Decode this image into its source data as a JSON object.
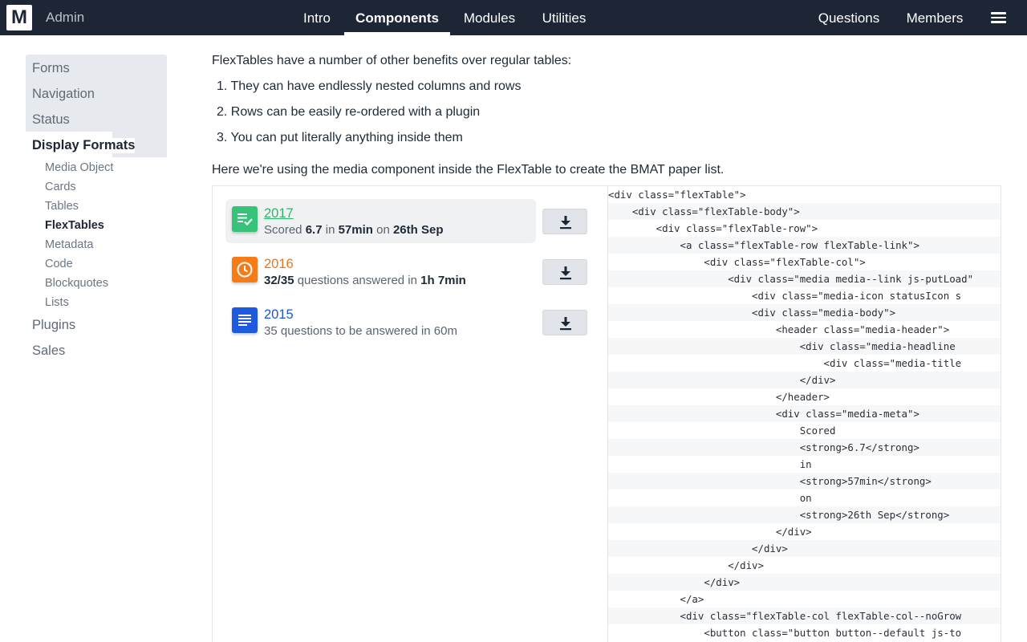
{
  "header": {
    "logo_letter": "M",
    "brand": "Admin",
    "nav": [
      "Intro",
      "Components",
      "Modules",
      "Utilities"
    ],
    "active_nav": "Components",
    "right_nav": [
      "Questions",
      "Members"
    ],
    "menu_icon": "hamburger-icon"
  },
  "sidebar": {
    "items": [
      "Forms",
      "Navigation",
      "Status",
      "Display Formats"
    ],
    "current": "Display Formats",
    "subitems": [
      "Media Object",
      "Cards",
      "Tables",
      "FlexTables",
      "Metadata",
      "Code",
      "Blockquotes",
      "Lists"
    ],
    "current_sub": "FlexTables",
    "items_after": [
      "Plugins",
      "Sales"
    ]
  },
  "content": {
    "intro": "FlexTables have a number of other benefits over regular tables:",
    "list": [
      "1. They can have endlessly nested columns and rows",
      "2. Rows can be easily re-ordered with a plugin",
      "3. You can put literally anything inside them"
    ],
    "usage": "Here we're using the media component inside the FlexTable to create the BMAT paper list."
  },
  "papers": [
    {
      "title": "2017",
      "title_color": "#2fb56b",
      "icon_color": "#37c27a",
      "icon": "checklist-icon",
      "meta": [
        {
          "text": "Scored ",
          "bold": false
        },
        {
          "text": "6.7",
          "bold": true
        },
        {
          "text": " in ",
          "bold": false
        },
        {
          "text": "57min",
          "bold": true
        },
        {
          "text": " on ",
          "bold": false
        },
        {
          "text": "26th Sep",
          "bold": true
        }
      ]
    },
    {
      "title": "2016",
      "title_color": "#f07314",
      "icon_color": "#f57c17",
      "icon": "clock-icon",
      "meta": [
        {
          "text": "32/35",
          "bold": true
        },
        {
          "text": " questions answered in ",
          "bold": false
        },
        {
          "text": "1h 7min",
          "bold": true
        }
      ]
    },
    {
      "title": "2015",
      "title_color": "#1a56d6",
      "icon_color": "#1d5ae0",
      "icon": "document-lines-icon",
      "meta": [
        {
          "text": "35 questions to be answered in 60m",
          "bold": false
        }
      ]
    }
  ],
  "download_icon": "download-icon",
  "code_lines": [
    "<div class=\"flexTable\">",
    "    <div class=\"flexTable-body\">",
    "        <div class=\"flexTable-row\">",
    "            <a class=\"flexTable-row flexTable-link\">",
    "                <div class=\"flexTable-col\">",
    "                    <div class=\"media media--link js-putLoad\"",
    "                        <div class=\"media-icon statusIcon s",
    "                        <div class=\"media-body\">",
    "                            <header class=\"media-header\">",
    "                                <div class=\"media-headline",
    "                                    <div class=\"media-title",
    "                                </div>",
    "                            </header>",
    "                            <div class=\"media-meta\">",
    "                                Scored",
    "                                <strong>6.7</strong>",
    "                                in",
    "                                <strong>57min</strong>",
    "                                on",
    "                                <strong>26th Sep</strong>",
    "                            </div>",
    "                        </div>",
    "                    </div>",
    "                </div>",
    "            </a>",
    "            <div class=\"flexTable-col flexTable-col--noGrow",
    "                <button class=\"button button--default js-to"
  ]
}
